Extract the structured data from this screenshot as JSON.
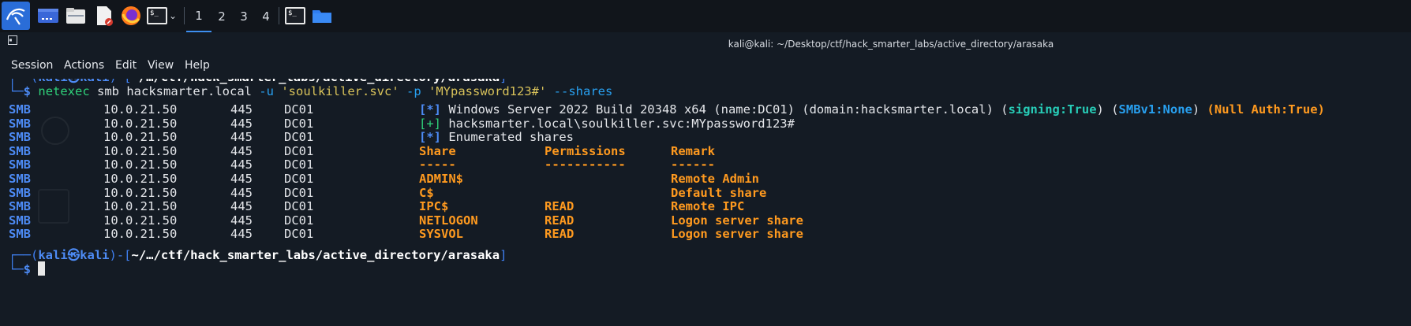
{
  "taskbar": {
    "workspaces": [
      "1",
      "2",
      "3",
      "4"
    ]
  },
  "window": {
    "title": "kali@kali: ~/Desktop/ctf/hack_smarter_labs/active_directory/arasaka",
    "menu": [
      "Session",
      "Actions",
      "Edit",
      "View",
      "Help"
    ]
  },
  "prompt": {
    "user": "kali",
    "at": "㉿",
    "host": "kali",
    "path": "~/…/ctf/hack_smarter_labs/active_directory/arasaka",
    "dollar": "$"
  },
  "command": {
    "tool": "netexec",
    "args": " smb hacksmarter.local ",
    "flag_u": "-u",
    "user": "'soulkiller.svc'",
    "flag_p": "-p",
    "password": "'MYpassword123#'",
    "shares_flag": "--shares"
  },
  "smb": {
    "proto": "SMB",
    "ip": "10.0.21.50",
    "port": "445",
    "host": "DC01"
  },
  "output": {
    "info_tag": "[*]",
    "plus_tag": "[+]",
    "line1_text": "Windows Server 2022 Build 20348 x64 (name:DC01) (domain:hacksmarter.local) (",
    "signing_label": "signing:True",
    "paren_close_open": ") (",
    "smbv1_label": "SMBv1:None",
    "paren_close": ") ",
    "null_auth": "(Null Auth:True)",
    "login_text": "hacksmarter.local\\soulkiller.svc:MYpassword123#",
    "enum_text": "Enumerated shares"
  },
  "shares_table": {
    "headers": {
      "share": "Share",
      "permissions": "Permissions",
      "remark": "Remark"
    },
    "underline": {
      "share": "-----",
      "permissions": "-----------",
      "remark": "------"
    },
    "rows": [
      {
        "share": "ADMIN$",
        "permissions": "",
        "remark": "Remote Admin"
      },
      {
        "share": "C$",
        "permissions": "",
        "remark": "Default share"
      },
      {
        "share": "IPC$",
        "permissions": "READ",
        "remark": "Remote IPC"
      },
      {
        "share": "NETLOGON",
        "permissions": "READ",
        "remark": "Logon server share"
      },
      {
        "share": "SYSVOL",
        "permissions": "READ",
        "remark": "Logon server share"
      }
    ]
  },
  "colors": {
    "background": "#141b24",
    "prompt_blue": "#3f7ff0",
    "tag_blue": "#4d8bf5",
    "accent_orange": "#ff9a1f",
    "signing_teal": "#27cbb6"
  }
}
